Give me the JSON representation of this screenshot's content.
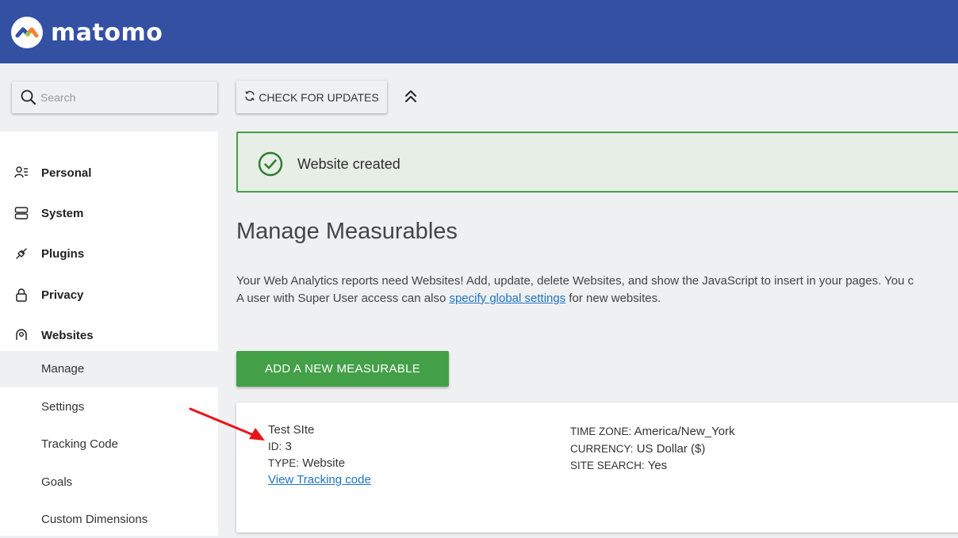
{
  "brand": {
    "name": "matomo"
  },
  "search": {
    "placeholder": "Search",
    "value": ""
  },
  "toolbar": {
    "check_updates_label": "CHECK FOR UPDATES"
  },
  "sidebar": {
    "sections": [
      {
        "label": "Personal",
        "icon": "user-settings-icon"
      },
      {
        "label": "System",
        "icon": "server-icon"
      },
      {
        "label": "Plugins",
        "icon": "plug-icon"
      },
      {
        "label": "Privacy",
        "icon": "lock-icon"
      },
      {
        "label": "Websites",
        "icon": "location-pin-icon"
      }
    ],
    "website_items": [
      {
        "label": "Manage",
        "active": true
      },
      {
        "label": "Settings"
      },
      {
        "label": "Tracking Code"
      },
      {
        "label": "Goals"
      },
      {
        "label": "Custom Dimensions"
      }
    ]
  },
  "notification": {
    "text": "Website created",
    "icon": "check-circle-icon"
  },
  "page": {
    "title": "Manage Measurables",
    "description_line1": "Your Web Analytics reports need Websites! Add, update, delete Websites, and show the JavaScript to insert in your pages. You c",
    "description_line2_prefix": "A user with Super User access can also ",
    "description_link": "specify global settings",
    "description_line2_suffix": " for new websites.",
    "add_button_label": "ADD A NEW MEASURABLE"
  },
  "site": {
    "name": "Test SIte",
    "id_label": "ID:",
    "id_value": "3",
    "type_label": "TYPE:",
    "type_value": "Website",
    "tracking_link": "View Tracking code",
    "timezone_label": "TIME ZONE:",
    "timezone_value": "America/New_York",
    "currency_label": "CURRENCY:",
    "currency_value": "US Dollar ($)",
    "sitesearch_label": "SITE SEARCH:",
    "sitesearch_value": "Yes"
  },
  "colors": {
    "header": "#3450a3",
    "success": "#43a047",
    "link": "#1e73c8",
    "annotation_arrow": "#e8141b"
  }
}
